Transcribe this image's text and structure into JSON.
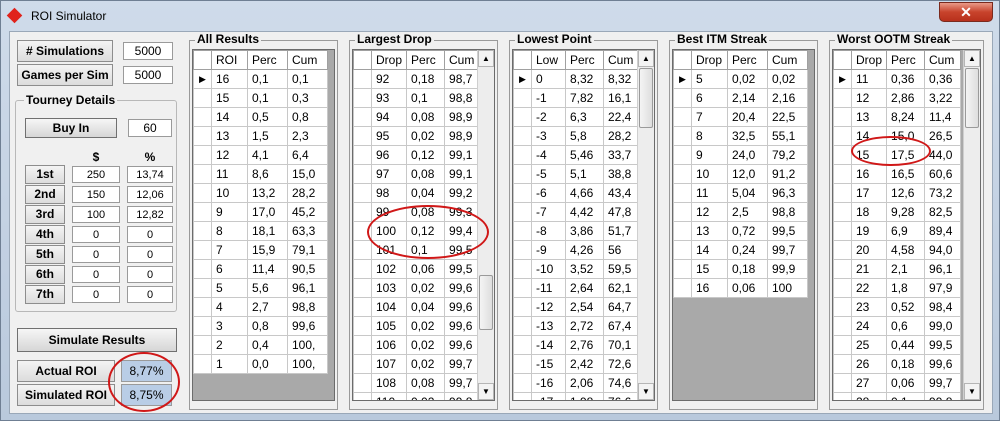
{
  "window": {
    "title": "ROI Simulator",
    "close_label": "✕"
  },
  "sims": {
    "label": "# Simulations",
    "value": "5000"
  },
  "games": {
    "label": "Games per Sim",
    "value": "5000"
  },
  "tourney": {
    "title": "Tourney Details",
    "buyin_label": "Buy In",
    "buyin_value": "60",
    "col_dollar": "$",
    "col_pct": "%",
    "places": [
      {
        "label": "1st",
        "dollar": "250",
        "pct": "13,74"
      },
      {
        "label": "2nd",
        "dollar": "150",
        "pct": "12,06"
      },
      {
        "label": "3rd",
        "dollar": "100",
        "pct": "12,82"
      },
      {
        "label": "4th",
        "dollar": "0",
        "pct": "0"
      },
      {
        "label": "5th",
        "dollar": "0",
        "pct": "0"
      },
      {
        "label": "6th",
        "dollar": "0",
        "pct": "0"
      },
      {
        "label": "7th",
        "dollar": "0",
        "pct": "0"
      }
    ]
  },
  "simulate_label": "Simulate Results",
  "actual_roi": {
    "label": "Actual ROI",
    "value": "8,77%"
  },
  "simulated_roi": {
    "label": "Simulated ROI",
    "value": "8,75%"
  },
  "grids": [
    {
      "title": "All Results",
      "cols": [
        "ROI",
        "Perc",
        "Cum"
      ],
      "rows": [
        [
          "16",
          "0,1",
          "0,1"
        ],
        [
          "15",
          "0,1",
          "0,3"
        ],
        [
          "14",
          "0,5",
          "0,8"
        ],
        [
          "13",
          "1,5",
          "2,3"
        ],
        [
          "12",
          "4,1",
          "6,4"
        ],
        [
          "11",
          "8,6",
          "15,0"
        ],
        [
          "10",
          "13,2",
          "28,2"
        ],
        [
          "9",
          "17,0",
          "45,2"
        ],
        [
          "8",
          "18,1",
          "63,3"
        ],
        [
          "7",
          "15,9",
          "79,1"
        ],
        [
          "6",
          "11,4",
          "90,5"
        ],
        [
          "5",
          "5,6",
          "96,1"
        ],
        [
          "4",
          "2,7",
          "98,8"
        ],
        [
          "3",
          "0,8",
          "99,6"
        ],
        [
          "2",
          "0,4",
          "100,"
        ],
        [
          "1",
          "0,0",
          "100,"
        ]
      ]
    },
    {
      "title": "Largest Drop",
      "cols": [
        "Drop",
        "Perc",
        "Cum"
      ],
      "rows": [
        [
          "92",
          "0,18",
          "98,7"
        ],
        [
          "93",
          "0,1",
          "98,8"
        ],
        [
          "94",
          "0,08",
          "98,9"
        ],
        [
          "95",
          "0,02",
          "98,9"
        ],
        [
          "96",
          "0,12",
          "99,1"
        ],
        [
          "97",
          "0,08",
          "99,1"
        ],
        [
          "98",
          "0,04",
          "99,2"
        ],
        [
          "99",
          "0,08",
          "99,3"
        ],
        [
          "100",
          "0,12",
          "99,4"
        ],
        [
          "101",
          "0,1",
          "99,5"
        ],
        [
          "102",
          "0,06",
          "99,5"
        ],
        [
          "103",
          "0,02",
          "99,6"
        ],
        [
          "104",
          "0,04",
          "99,6"
        ],
        [
          "105",
          "0,02",
          "99,6"
        ],
        [
          "106",
          "0,02",
          "99,6"
        ],
        [
          "107",
          "0,02",
          "99,7"
        ],
        [
          "108",
          "0,08",
          "99,7"
        ],
        [
          "110",
          "0,02",
          "99,8"
        ]
      ]
    },
    {
      "title": "Lowest Point",
      "cols": [
        "Low",
        "Perc",
        "Cum"
      ],
      "rows": [
        [
          "0",
          "8,32",
          "8,32"
        ],
        [
          "-1",
          "7,82",
          "16,1"
        ],
        [
          "-2",
          "6,3",
          "22,4"
        ],
        [
          "-3",
          "5,8",
          "28,2"
        ],
        [
          "-4",
          "5,46",
          "33,7"
        ],
        [
          "-5",
          "5,1",
          "38,8"
        ],
        [
          "-6",
          "4,66",
          "43,4"
        ],
        [
          "-7",
          "4,42",
          "47,8"
        ],
        [
          "-8",
          "3,86",
          "51,7"
        ],
        [
          "-9",
          "4,26",
          "56"
        ],
        [
          "-10",
          "3,52",
          "59,5"
        ],
        [
          "-11",
          "2,64",
          "62,1"
        ],
        [
          "-12",
          "2,54",
          "64,7"
        ],
        [
          "-13",
          "2,72",
          "67,4"
        ],
        [
          "-14",
          "2,76",
          "70,1"
        ],
        [
          "-15",
          "2,42",
          "72,6"
        ],
        [
          "-16",
          "2,06",
          "74,6"
        ],
        [
          "-17",
          "1,98",
          "76,6"
        ]
      ]
    },
    {
      "title": "Best ITM Streak",
      "cols": [
        "Drop",
        "Perc",
        "Cum"
      ],
      "rows": [
        [
          "5",
          "0,02",
          "0,02"
        ],
        [
          "6",
          "2,14",
          "2,16"
        ],
        [
          "7",
          "20,4",
          "22,5"
        ],
        [
          "8",
          "32,5",
          "55,1"
        ],
        [
          "9",
          "24,0",
          "79,2"
        ],
        [
          "10",
          "12,0",
          "91,2"
        ],
        [
          "11",
          "5,04",
          "96,3"
        ],
        [
          "12",
          "2,5",
          "98,8"
        ],
        [
          "13",
          "0,72",
          "99,5"
        ],
        [
          "14",
          "0,24",
          "99,7"
        ],
        [
          "15",
          "0,18",
          "99,9"
        ],
        [
          "16",
          "0,06",
          "100"
        ]
      ]
    },
    {
      "title": "Worst OOTM Streak",
      "cols": [
        "Drop",
        "Perc",
        "Cum"
      ],
      "rows": [
        [
          "11",
          "0,36",
          "0,36"
        ],
        [
          "12",
          "2,86",
          "3,22"
        ],
        [
          "13",
          "8,24",
          "11,4"
        ],
        [
          "14",
          "15,0",
          "26,5"
        ],
        [
          "15",
          "17,5",
          "44,0"
        ],
        [
          "16",
          "16,5",
          "60,6"
        ],
        [
          "17",
          "12,6",
          "73,2"
        ],
        [
          "18",
          "9,28",
          "82,5"
        ],
        [
          "19",
          "6,9",
          "89,4"
        ],
        [
          "20",
          "4,58",
          "94,0"
        ],
        [
          "21",
          "2,1",
          "96,1"
        ],
        [
          "22",
          "1,8",
          "97,9"
        ],
        [
          "23",
          "0,52",
          "98,4"
        ],
        [
          "24",
          "0,6",
          "99,0"
        ],
        [
          "25",
          "0,44",
          "99,5"
        ],
        [
          "26",
          "0,18",
          "99,6"
        ],
        [
          "27",
          "0,06",
          "99,7"
        ],
        [
          "28",
          "0,1",
          "99,8"
        ]
      ]
    }
  ],
  "colors": {
    "highlight": "#d01818",
    "roi_value_bg": "#b9cde6",
    "grid_empty": "#a9a9a9"
  }
}
